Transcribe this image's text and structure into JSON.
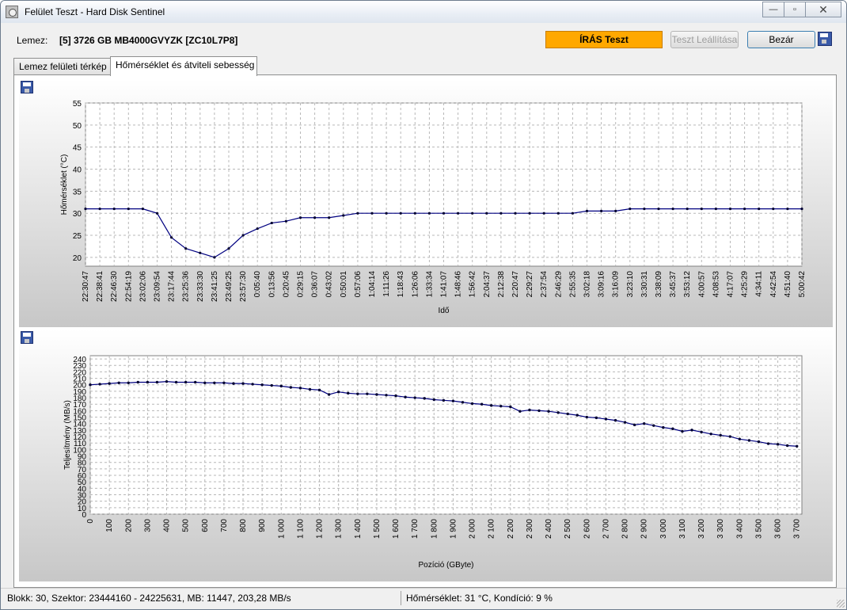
{
  "window": {
    "title": "Felület Teszt - Hard Disk Sentinel",
    "minimize": "—",
    "restore": "▫",
    "close": "✕"
  },
  "toolbar": {
    "disk_label": "Lemez:",
    "disk_name": "[5] 3726 GB  MB4000GVYZK [ZC10L7P8]",
    "status": "ÍRÁS Teszt",
    "stop_button": "Teszt Leállítása",
    "close_button": "Bezár"
  },
  "tabs": [
    {
      "label": "Lemez felületi térkép"
    },
    {
      "label": "Hőmérséklet és átviteli sebesség"
    }
  ],
  "statusbar": {
    "left": "Blokk: 30, Szektor: 23444160 - 24225631, MB: 11447, 203,28 MB/s",
    "right": "Hőmérséklet: 31  °C,  Kondíció: 9 %"
  },
  "chart_data": [
    {
      "type": "line",
      "ylabel": "Hőmérséklet (°C)",
      "xlabel": "Idő",
      "ylim": [
        18,
        55
      ],
      "yticks": [
        20,
        25,
        30,
        35,
        40,
        45,
        50,
        55
      ],
      "grid": true,
      "categories": [
        "22:30:47",
        "22:38:41",
        "22:46:30",
        "22:54:19",
        "23:02:06",
        "23:09:54",
        "23:17:44",
        "23:25:36",
        "23:33:30",
        "23:41:25",
        "23:49:25",
        "23:57:30",
        "0:05:40",
        "0:13:56",
        "0:20:45",
        "0:29:15",
        "0:36:07",
        "0:43:02",
        "0:50:01",
        "0:57:06",
        "1:04:14",
        "1:11:26",
        "1:18:43",
        "1:26:06",
        "1:33:34",
        "1:41:07",
        "1:48:46",
        "1:56:42",
        "2:04:37",
        "2:12:38",
        "2:20:47",
        "2:29:27",
        "2:37:54",
        "2:46:29",
        "2:55:35",
        "3:02:18",
        "3:09:16",
        "3:16:09",
        "3:23:10",
        "3:30:31",
        "3:38:09",
        "3:45:37",
        "3:53:12",
        "4:00:57",
        "4:08:53",
        "4:17:07",
        "4:25:29",
        "4:34:11",
        "4:42:54",
        "4:51:40",
        "5:00:42"
      ],
      "values": [
        31,
        31,
        31,
        31,
        31,
        30,
        24.5,
        22,
        21,
        20,
        22,
        25,
        26.5,
        27.8,
        28.2,
        29,
        29,
        29,
        29.5,
        30,
        30,
        30,
        30,
        30,
        30,
        30,
        30,
        30,
        30,
        30,
        30,
        30,
        30,
        30,
        30,
        30.5,
        30.5,
        30.5,
        31,
        31,
        31,
        31,
        31,
        31,
        31,
        31,
        31,
        31,
        31,
        31,
        31
      ]
    },
    {
      "type": "line",
      "ylabel": "Teljesítmény (MB/s)",
      "xlabel": "Pozíció (GByte)",
      "xlim": [
        0,
        3726
      ],
      "ylim": [
        0,
        245
      ],
      "yticks": [
        0,
        10,
        20,
        30,
        40,
        50,
        60,
        70,
        80,
        90,
        100,
        110,
        120,
        130,
        140,
        150,
        160,
        170,
        180,
        190,
        200,
        210,
        220,
        230,
        240
      ],
      "xticks": [
        0,
        100,
        200,
        300,
        400,
        500,
        600,
        700,
        800,
        900,
        1000,
        1100,
        1200,
        1300,
        1400,
        1500,
        1600,
        1700,
        1800,
        1900,
        2000,
        2100,
        2200,
        2300,
        2400,
        2500,
        2600,
        2700,
        2800,
        2900,
        3000,
        3100,
        3200,
        3300,
        3400,
        3500,
        3600,
        3700
      ],
      "xtick_labels": [
        "0",
        "100",
        "200",
        "300",
        "400",
        "500",
        "600",
        "700",
        "800",
        "900",
        "1 000",
        "1 100",
        "1 200",
        "1 300",
        "1 400",
        "1 500",
        "1 600",
        "1 700",
        "1 800",
        "1 900",
        "2 000",
        "2 100",
        "2 200",
        "2 300",
        "2 400",
        "2 500",
        "2 600",
        "2 700",
        "2 800",
        "2 900",
        "3 000",
        "3 100",
        "3 200",
        "3 300",
        "3 400",
        "3 500",
        "3 600",
        "3 700"
      ],
      "grid": true,
      "x": [
        0,
        50,
        100,
        150,
        200,
        250,
        300,
        350,
        400,
        450,
        500,
        550,
        600,
        650,
        700,
        750,
        800,
        850,
        900,
        950,
        1000,
        1050,
        1100,
        1150,
        1200,
        1250,
        1300,
        1350,
        1400,
        1450,
        1500,
        1550,
        1600,
        1650,
        1700,
        1750,
        1800,
        1850,
        1900,
        1950,
        2000,
        2050,
        2100,
        2150,
        2200,
        2250,
        2300,
        2350,
        2400,
        2450,
        2500,
        2550,
        2600,
        2650,
        2700,
        2750,
        2800,
        2850,
        2900,
        2950,
        3000,
        3050,
        3100,
        3150,
        3200,
        3250,
        3300,
        3350,
        3400,
        3450,
        3500,
        3550,
        3600,
        3650,
        3700
      ],
      "values": [
        200,
        201,
        202,
        203,
        203,
        204,
        204,
        204,
        205,
        204,
        204,
        204,
        203,
        203,
        203,
        202,
        202,
        201,
        200,
        199,
        198,
        196,
        195,
        193,
        192,
        185,
        189,
        187,
        186,
        186,
        185,
        184,
        183,
        181,
        180,
        179,
        177,
        176,
        175,
        173,
        171,
        170,
        168,
        167,
        166,
        159,
        161,
        160,
        159,
        157,
        155,
        153,
        150,
        149,
        147,
        145,
        142,
        138,
        140,
        137,
        134,
        132,
        128,
        130,
        127,
        124,
        122,
        120,
        116,
        114,
        112,
        109,
        108,
        106,
        105
      ]
    }
  ]
}
